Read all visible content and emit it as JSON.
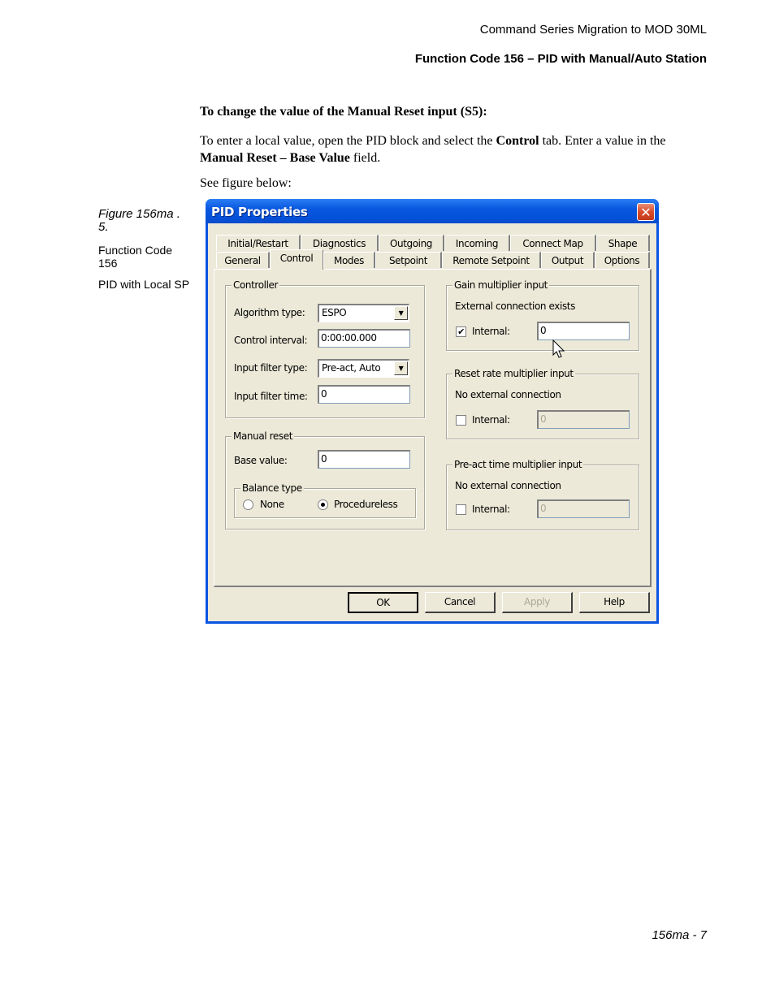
{
  "header": {
    "doc_title": "Command Series Migration to MOD 30ML",
    "section_title": "Function Code 156 – PID with Manual/Auto Station"
  },
  "body": {
    "heading": "To change the value of the Manual Reset input (S5):",
    "para1_a": "To enter a local value, open the PID block and select the ",
    "para1_b": "Control",
    "para1_c": " tab. Enter a value in the ",
    "para1_d": "Manual Reset – Base Value",
    "para1_e": " field.",
    "para2": "See figure below:"
  },
  "sidebar": {
    "figure_caption": "Figure 156ma . 5.",
    "line1": "Function Code 156",
    "line2": "PID with Local SP"
  },
  "dialog": {
    "title": "PID Properties",
    "close_icon": "close-x",
    "tabs_row1": [
      "Initial/Restart",
      "Diagnostics",
      "Outgoing",
      "Incoming",
      "Connect Map",
      "Shape"
    ],
    "tabs_row2": [
      "General",
      "Control",
      "Modes",
      "Setpoint",
      "Remote Setpoint",
      "Output",
      "Options"
    ],
    "selected_tab": "Control",
    "controller": {
      "group_label": "Controller",
      "algorithm_label": "Algorithm type:",
      "algorithm_value": "ESPO",
      "interval_label": "Control interval:",
      "interval_value": "0:00:00.000",
      "filter_type_label": "Input filter type:",
      "filter_type_value": "Pre-act, Auto",
      "filter_time_label": "Input filter time:",
      "filter_time_value": "0"
    },
    "manual_reset": {
      "group_label": "Manual reset",
      "base_label": "Base value:",
      "base_value": "0",
      "balance_label": "Balance type",
      "option_none": "None",
      "option_procedureless": "Procedureless",
      "selected": "Procedureless"
    },
    "gain": {
      "group_label": "Gain multiplier input",
      "status": "External connection exists",
      "internal_label": "Internal:",
      "internal_checked": true,
      "value": "0"
    },
    "reset_rate": {
      "group_label": "Reset rate multiplier input",
      "status": "No external connection",
      "internal_label": "Internal:",
      "internal_checked": false,
      "value": "0"
    },
    "preact": {
      "group_label": "Pre-act time multiplier input",
      "status": "No external connection",
      "internal_label": "Internal:",
      "internal_checked": false,
      "value": "0"
    },
    "buttons": {
      "ok": "OK",
      "cancel": "Cancel",
      "apply": "Apply",
      "help": "Help"
    }
  },
  "footer": {
    "page_number": "156ma - 7"
  }
}
